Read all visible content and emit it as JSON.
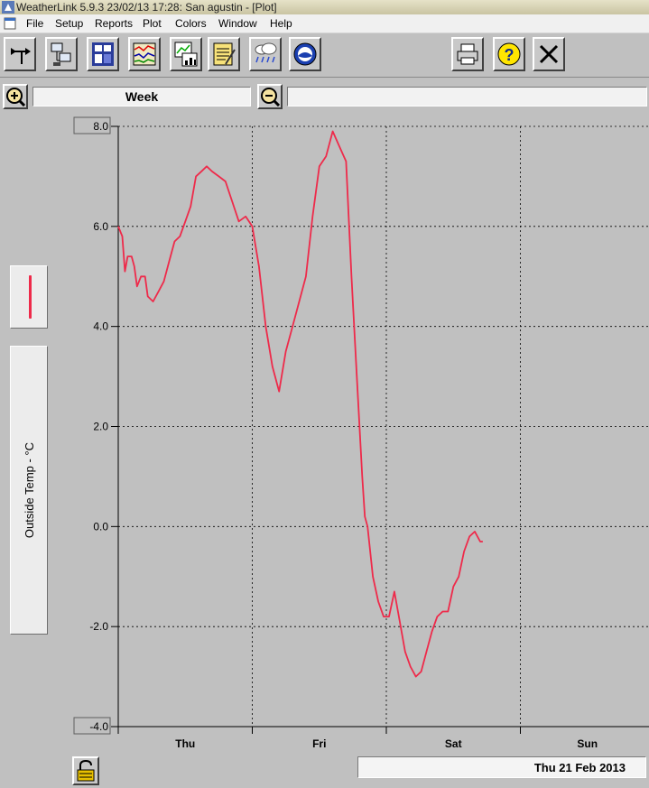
{
  "window": {
    "title": "WeatherLink 5.9.3  23/02/13  17:28: San agustin - [Plot]"
  },
  "menu": {
    "items": [
      "File",
      "Setup",
      "Reports",
      "Plot",
      "Colors",
      "Window",
      "Help"
    ]
  },
  "toolbar": {
    "left_icons": [
      "wind-vane-icon",
      "station-transfer-icon",
      "bulletin-icon",
      "strip-chart-icon",
      "graph-icon",
      "notepad-icon",
      "rain-cloud-icon",
      "noaa-icon"
    ],
    "right_icons": [
      "printer-icon",
      "help-icon",
      "close-icon"
    ]
  },
  "range": {
    "period": "Week",
    "zoom_in_icon": "zoom-in-icon",
    "zoom_out_icon": "zoom-out-icon"
  },
  "legend": {
    "series_color": "#ee2a4a",
    "axis_label": "Outside Temp - °C"
  },
  "chart_data": {
    "type": "line",
    "title": "",
    "xlabel": "",
    "ylabel": "Outside Temp - °C",
    "ylim": [
      -4.0,
      8.0
    ],
    "yticks": [
      "8.0",
      "6.0",
      "4.0",
      "2.0",
      "0.0",
      "-2.0",
      "-4.0"
    ],
    "xticks": [
      "Thu",
      "Fri",
      "Sat",
      "Sun"
    ],
    "x_unit": "days since Thu 00:00",
    "xlim": [
      0,
      4
    ],
    "grid": true,
    "series": [
      {
        "color": "#ee2a4a",
        "x": [
          0.0,
          0.03,
          0.05,
          0.07,
          0.1,
          0.12,
          0.14,
          0.17,
          0.2,
          0.22,
          0.26,
          0.3,
          0.34,
          0.38,
          0.42,
          0.46,
          0.5,
          0.54,
          0.58,
          0.62,
          0.66,
          0.7,
          0.75,
          0.8,
          0.85,
          0.9,
          0.95,
          1.0,
          1.05,
          1.1,
          1.15,
          1.2,
          1.25,
          1.3,
          1.35,
          1.4,
          1.45,
          1.5,
          1.55,
          1.6,
          1.65,
          1.7,
          1.74,
          1.78,
          1.82,
          1.84,
          1.86,
          1.9,
          1.94,
          1.98,
          2.02,
          2.06,
          2.1,
          2.14,
          2.18,
          2.22,
          2.26,
          2.3,
          2.34,
          2.38,
          2.42,
          2.46,
          2.5,
          2.54,
          2.58,
          2.62,
          2.66,
          2.7,
          2.72
        ],
        "y": [
          6.0,
          5.8,
          5.1,
          5.4,
          5.4,
          5.2,
          4.8,
          5.0,
          5.0,
          4.6,
          4.5,
          4.7,
          4.9,
          5.3,
          5.7,
          5.8,
          6.1,
          6.4,
          7.0,
          7.1,
          7.2,
          7.1,
          7.0,
          6.9,
          6.5,
          6.1,
          6.2,
          6.0,
          5.2,
          4.0,
          3.2,
          2.7,
          3.5,
          4.0,
          4.5,
          5.0,
          6.2,
          7.2,
          7.4,
          7.9,
          7.6,
          7.3,
          5.0,
          3.0,
          1.0,
          0.2,
          0.0,
          -1.0,
          -1.5,
          -1.8,
          -1.8,
          -1.3,
          -1.9,
          -2.5,
          -2.8,
          -3.0,
          -2.9,
          -2.5,
          -2.1,
          -1.8,
          -1.7,
          -1.7,
          -1.2,
          -1.0,
          -0.5,
          -0.2,
          -0.1,
          -0.3,
          -0.3
        ]
      }
    ]
  },
  "footer": {
    "date": "Thu 21 Feb 2013",
    "lock_icon": "padlock-open-icon"
  }
}
